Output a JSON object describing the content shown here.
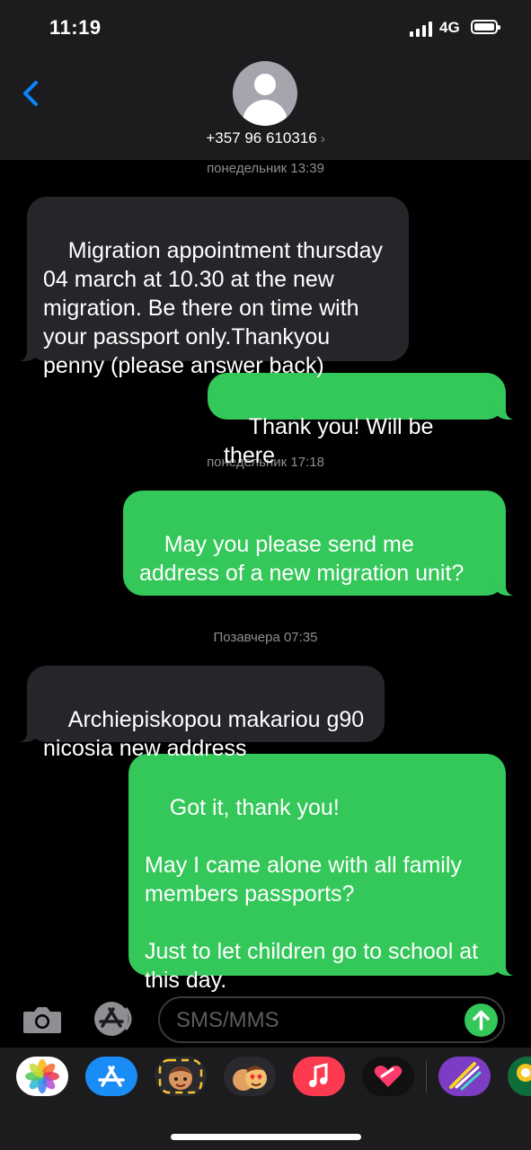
{
  "status": {
    "time": "11:19",
    "network": "4G"
  },
  "contact": {
    "number": "+357 96 610316",
    "chevron": "›"
  },
  "thread": [
    {
      "kind": "stamp",
      "text": "понедельник 13:39"
    },
    {
      "kind": "in",
      "text": "Migration appointment thursday 04 march at 10.30 at the new migration. Be there on time with your passport only.Thankyou penny (please answer back)"
    },
    {
      "kind": "out",
      "text": "Thank you! Will be there"
    },
    {
      "kind": "stamp",
      "text": "понедельник 17:18"
    },
    {
      "kind": "out",
      "text": "May you please send me address of a new migration unit?"
    },
    {
      "kind": "stamp",
      "text": "Позавчера 07:35"
    },
    {
      "kind": "in",
      "text": "Archiepiskopou makariou g90 nicosia new address"
    },
    {
      "kind": "out",
      "text": "Got it, thank you!\n\nMay I came alone with all family members passports?\n\nJust to let children go to school at this day."
    }
  ],
  "compose": {
    "placeholder": "SMS/MMS"
  },
  "app_strip": [
    {
      "name": "photos-app-icon"
    },
    {
      "name": "app-store-icon"
    },
    {
      "name": "memoji-icon"
    },
    {
      "name": "animoji-icon"
    },
    {
      "name": "music-icon"
    },
    {
      "name": "digital-touch-icon"
    },
    {
      "name": "stickers-icon"
    },
    {
      "name": "pool-game-icon"
    }
  ],
  "colors": {
    "incoming": "#26252a",
    "outgoing": "#34c759",
    "accent": "#0a84ff"
  }
}
